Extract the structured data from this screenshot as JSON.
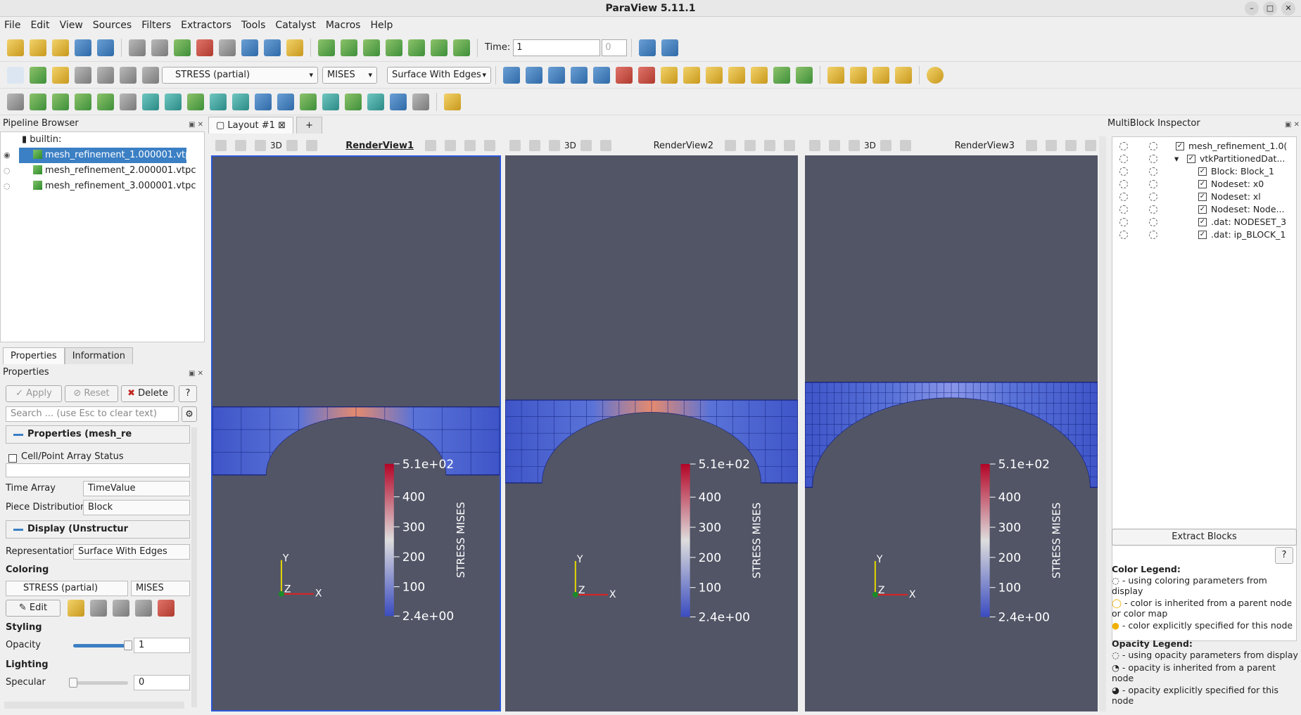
{
  "window": {
    "title": "ParaView 5.11.1"
  },
  "menu": [
    "File",
    "Edit",
    "View",
    "Sources",
    "Filters",
    "Extractors",
    "Tools",
    "Catalyst",
    "Macros",
    "Help"
  ],
  "toolbar": {
    "time_label": "Time:",
    "time_value": "1",
    "time_index": "0",
    "color_array": "STRESS (partial)",
    "component": "MISES",
    "representation": "Surface With Edges"
  },
  "pipeline": {
    "title": "Pipeline Browser",
    "root": "builtin:",
    "items": [
      "mesh_refinement_1.000001.vtpc",
      "mesh_refinement_2.000001.vtpc",
      "mesh_refinement_3.000001.vtpc"
    ]
  },
  "properties": {
    "tabs": [
      "Properties",
      "Information"
    ],
    "title": "Properties",
    "apply": "Apply",
    "reset": "Reset",
    "delete": "Delete",
    "help": "?",
    "search_placeholder": "Search ... (use Esc to clear text)",
    "section_props": "Properties (mesh_re",
    "cellpoint": "Cell/Point Array Status",
    "time_array_label": "Time Array",
    "time_array_value": "TimeValue",
    "piece_label": "Piece Distribution",
    "piece_value": "Block",
    "section_display": "Display (Unstructur",
    "representation_label": "Representation",
    "representation_value": "Surface With Edges",
    "coloring": "Coloring",
    "color_array": "STRESS (partial)",
    "component": "MISES",
    "edit": "Edit",
    "styling": "Styling",
    "opacity_label": "Opacity",
    "opacity_value": "1",
    "opacity": 1.0,
    "lighting": "Lighting",
    "specular_label": "Specular",
    "specular_value": "0",
    "specular": 0.0
  },
  "layout": {
    "tab": "Layout #1",
    "plus": "+",
    "views": [
      {
        "name": "RenderView1",
        "mode": "3D",
        "mesh_top": 0.452,
        "mesh_bottom": 0.575,
        "hot": 0.8
      },
      {
        "name": "RenderView2",
        "mode": "3D",
        "mesh_top": 0.44,
        "mesh_bottom": 0.589,
        "hot": 0.95
      },
      {
        "name": "RenderView3",
        "mode": "3D",
        "mesh_top": 0.408,
        "mesh_bottom": 0.597,
        "hot": 0.55
      }
    ]
  },
  "colorbar": {
    "title": "STRESS MISES",
    "max": "5.1e+02",
    "min": "2.4e+00",
    "ticks": [
      "400",
      "300",
      "200",
      "100"
    ],
    "tick_values": [
      400,
      300,
      200,
      100
    ],
    "range": [
      2.4,
      510
    ],
    "colors": {
      "low": "#3b4cc0",
      "mid": "#dddddd",
      "high": "#b40426"
    }
  },
  "axes": {
    "x": "X",
    "y": "Y",
    "z": "Z"
  },
  "mbi": {
    "title": "MultiBlock Inspector",
    "rows": [
      {
        "label": "mesh_refinement_1.0(",
        "indent": 0
      },
      {
        "label": "vtkPartitionedDat...",
        "indent": 1,
        "expand": "▾"
      },
      {
        "label": "Block: Block_1",
        "indent": 2
      },
      {
        "label": "Nodeset: x0",
        "indent": 2
      },
      {
        "label": "Nodeset: xl",
        "indent": 2
      },
      {
        "label": "Nodeset: Node...",
        "indent": 2
      },
      {
        "label": ".dat: NODESET_3",
        "indent": 2
      },
      {
        "label": ".dat: ip_BLOCK_1",
        "indent": 2
      }
    ],
    "extract": "Extract Blocks",
    "color_legend_title": "Color Legend:",
    "color_legend": [
      "- using coloring parameters from display",
      "- color is inherited from a parent node or color map",
      "- color explicitly specified for this node"
    ],
    "opacity_legend_title": "Opacity Legend:",
    "opacity_legend": [
      "- using opacity parameters from display",
      "- opacity is inherited from a parent node",
      "- opacity explicitly specified for this node"
    ]
  }
}
